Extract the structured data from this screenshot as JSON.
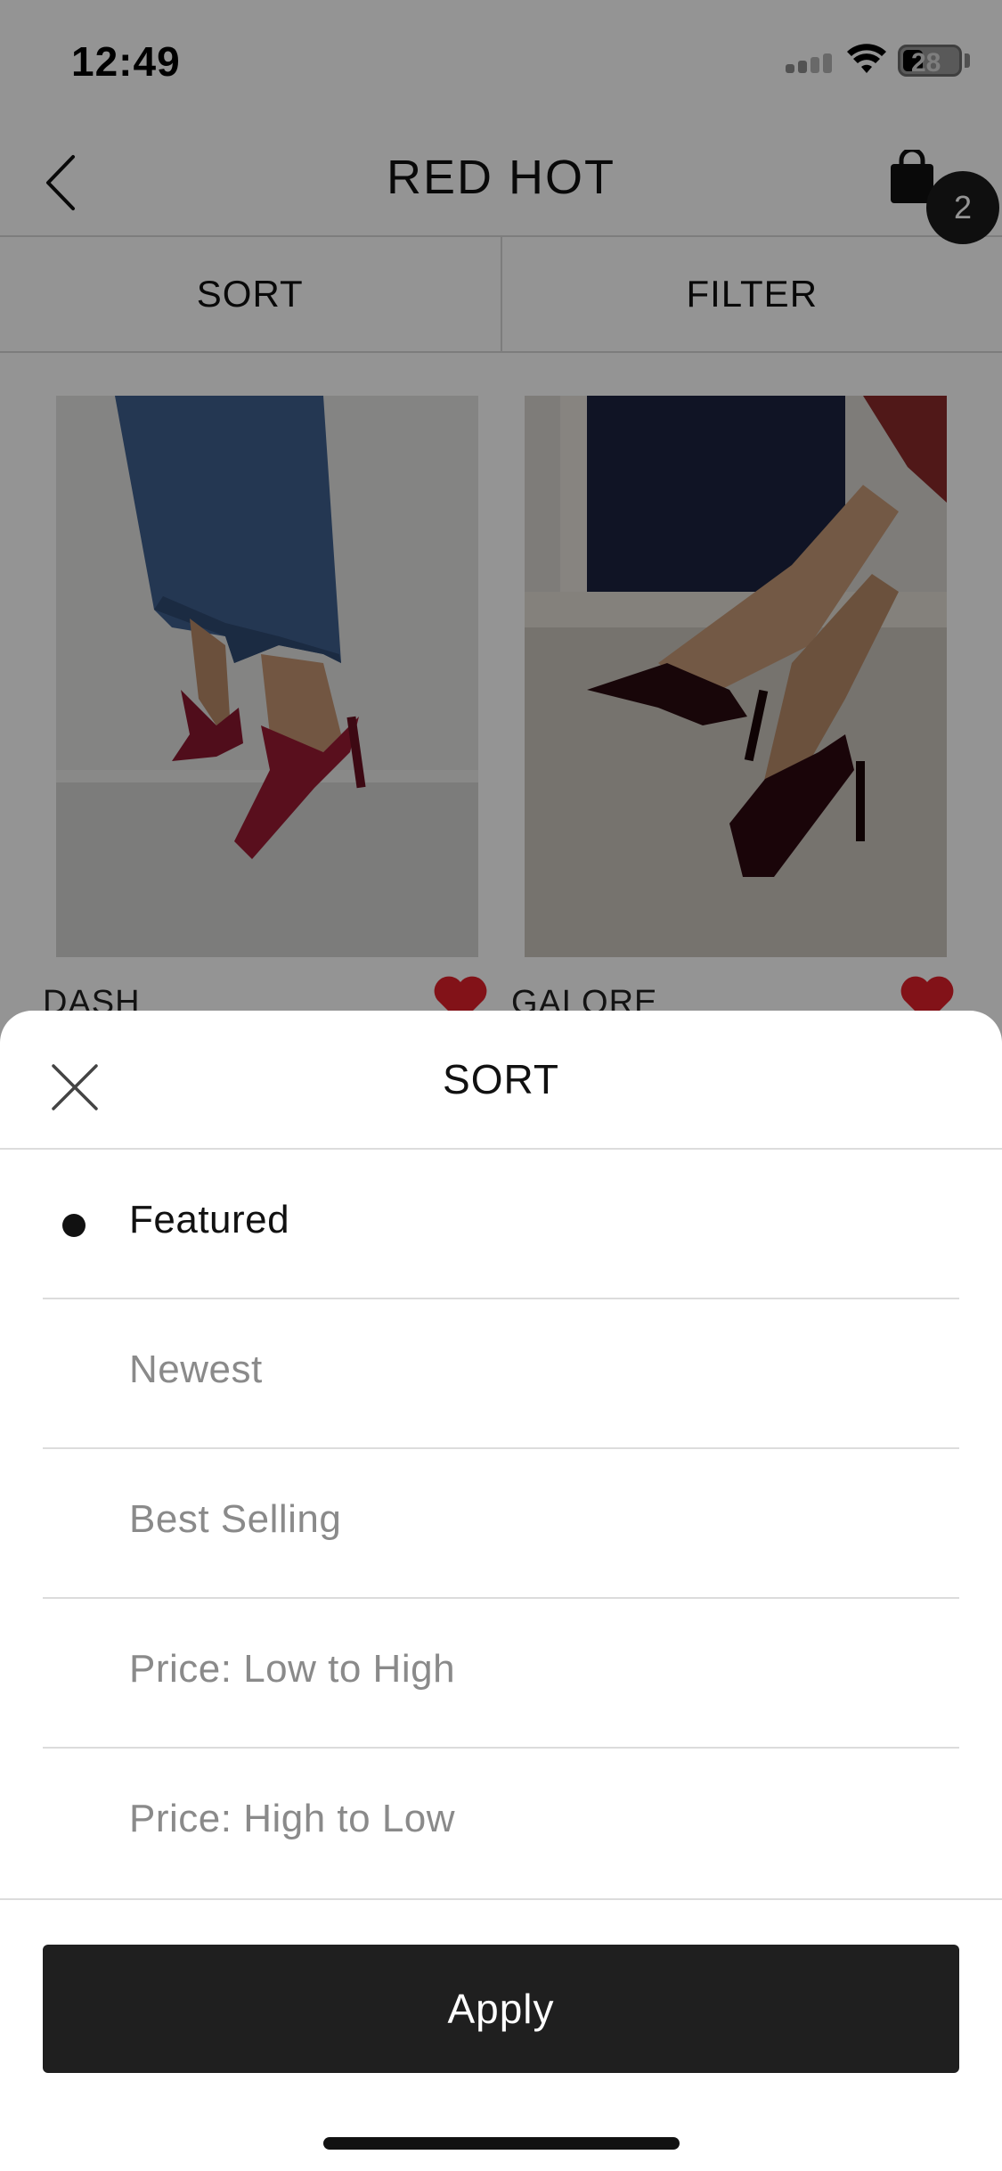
{
  "status_bar": {
    "time": "12:49",
    "battery": "28"
  },
  "header": {
    "title": "RED HOT",
    "cart_count": "2"
  },
  "toolbar": {
    "sort_label": "SORT",
    "filter_label": "FILTER"
  },
  "products": [
    {
      "name": "DASH",
      "image": "red-slingback-pump-photo"
    },
    {
      "name": "GALORE",
      "image": "burgundy-patent-ankle-strap-pump-photo"
    }
  ],
  "sort_sheet": {
    "title": "SORT",
    "options": [
      {
        "label": "Featured",
        "selected": true
      },
      {
        "label": "Newest",
        "selected": false
      },
      {
        "label": "Best Selling",
        "selected": false
      },
      {
        "label": "Price: Low to High",
        "selected": false
      },
      {
        "label": "Price: High to Low",
        "selected": false
      }
    ],
    "apply_label": "Apply"
  },
  "colors": {
    "accent_dark": "#1f1f1f",
    "heart_red": "#e0202a",
    "muted_text": "#8a8a8a"
  },
  "icons": [
    "back-icon",
    "shopping-bag-icon",
    "heart-icon",
    "close-icon",
    "wifi-icon",
    "signal-icon",
    "battery-icon"
  ]
}
